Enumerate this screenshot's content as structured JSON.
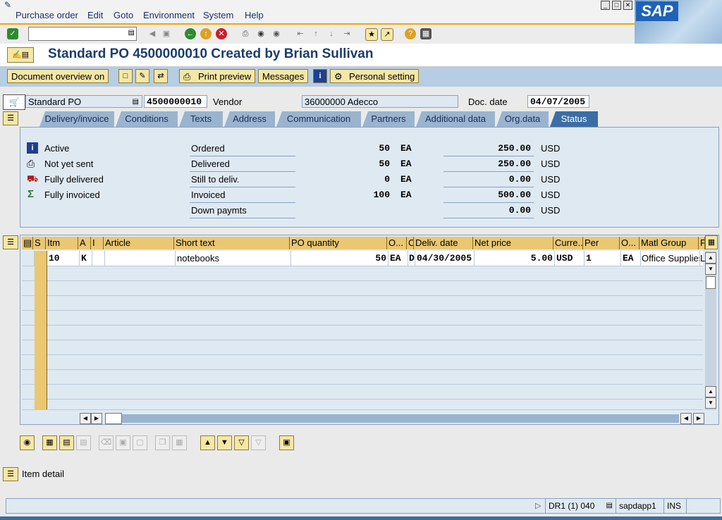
{
  "menu": {
    "items": [
      "Purchase order",
      "Edit",
      "Goto",
      "Environment",
      "System",
      "Help"
    ]
  },
  "window": {
    "title": "Standard PO 4500000010 Created by Brian Sullivan",
    "logo": "SAP"
  },
  "app_toolbar": {
    "document_overview": "Document overview on",
    "print_preview": "Print preview",
    "messages": "Messages",
    "personal_setting": "Personal setting"
  },
  "header": {
    "doc_type": "Standard PO",
    "po_number": "4500000010",
    "vendor_label": "Vendor",
    "vendor_value": "36000000 Adecco",
    "doc_date_label": "Doc. date",
    "doc_date": "04/07/2005"
  },
  "tabs": [
    "Delivery/invoice",
    "Conditions",
    "Texts",
    "Address",
    "Communication",
    "Partners",
    "Additional data",
    "Org.data",
    "Status"
  ],
  "status": {
    "left": [
      {
        "icon": "info-icon",
        "text": "Active"
      },
      {
        "icon": "printer-icon",
        "text": "Not yet sent"
      },
      {
        "icon": "truck-icon",
        "text": "Fully delivered"
      },
      {
        "icon": "sigma-icon",
        "text": "Fully invoiced"
      }
    ],
    "rows": [
      {
        "label": "Ordered",
        "qty": "50",
        "unit": "EA",
        "amount": "250.00",
        "currency": "USD"
      },
      {
        "label": "Delivered",
        "qty": "50",
        "unit": "EA",
        "amount": "250.00",
        "currency": "USD"
      },
      {
        "label": "Still to deliv.",
        "qty": "0",
        "unit": "EA",
        "amount": "0.00",
        "currency": "USD"
      },
      {
        "label": "Invoiced",
        "qty": "100",
        "unit": "EA",
        "amount": "500.00",
        "currency": "USD"
      },
      {
        "label": "Down paymts",
        "qty": "",
        "unit": "",
        "amount": "0.00",
        "currency": "USD"
      }
    ]
  },
  "grid": {
    "headers": [
      "S",
      "Itm",
      "A",
      "I",
      "Article",
      "Short text",
      "PO quantity",
      "O...",
      "C",
      "Deliv. date",
      "Net price",
      "Curre...",
      "Per",
      "O...",
      "Matl Group",
      "P"
    ],
    "row1": {
      "itm": "10",
      "a": "K",
      "short_text": "notebooks",
      "po_qty": "50",
      "o_unit": "EA",
      "c": "D",
      "deliv_date": "04/30/2005",
      "net_price": "5.00",
      "currency": "USD",
      "per": "1",
      "o2": "EA",
      "matl_group": "Office Supplies",
      "p": "L"
    }
  },
  "item_detail": "Item detail",
  "statusbar": {
    "system": "DR1 (1) 040",
    "server": "sapdapp1",
    "mode": "INS"
  }
}
